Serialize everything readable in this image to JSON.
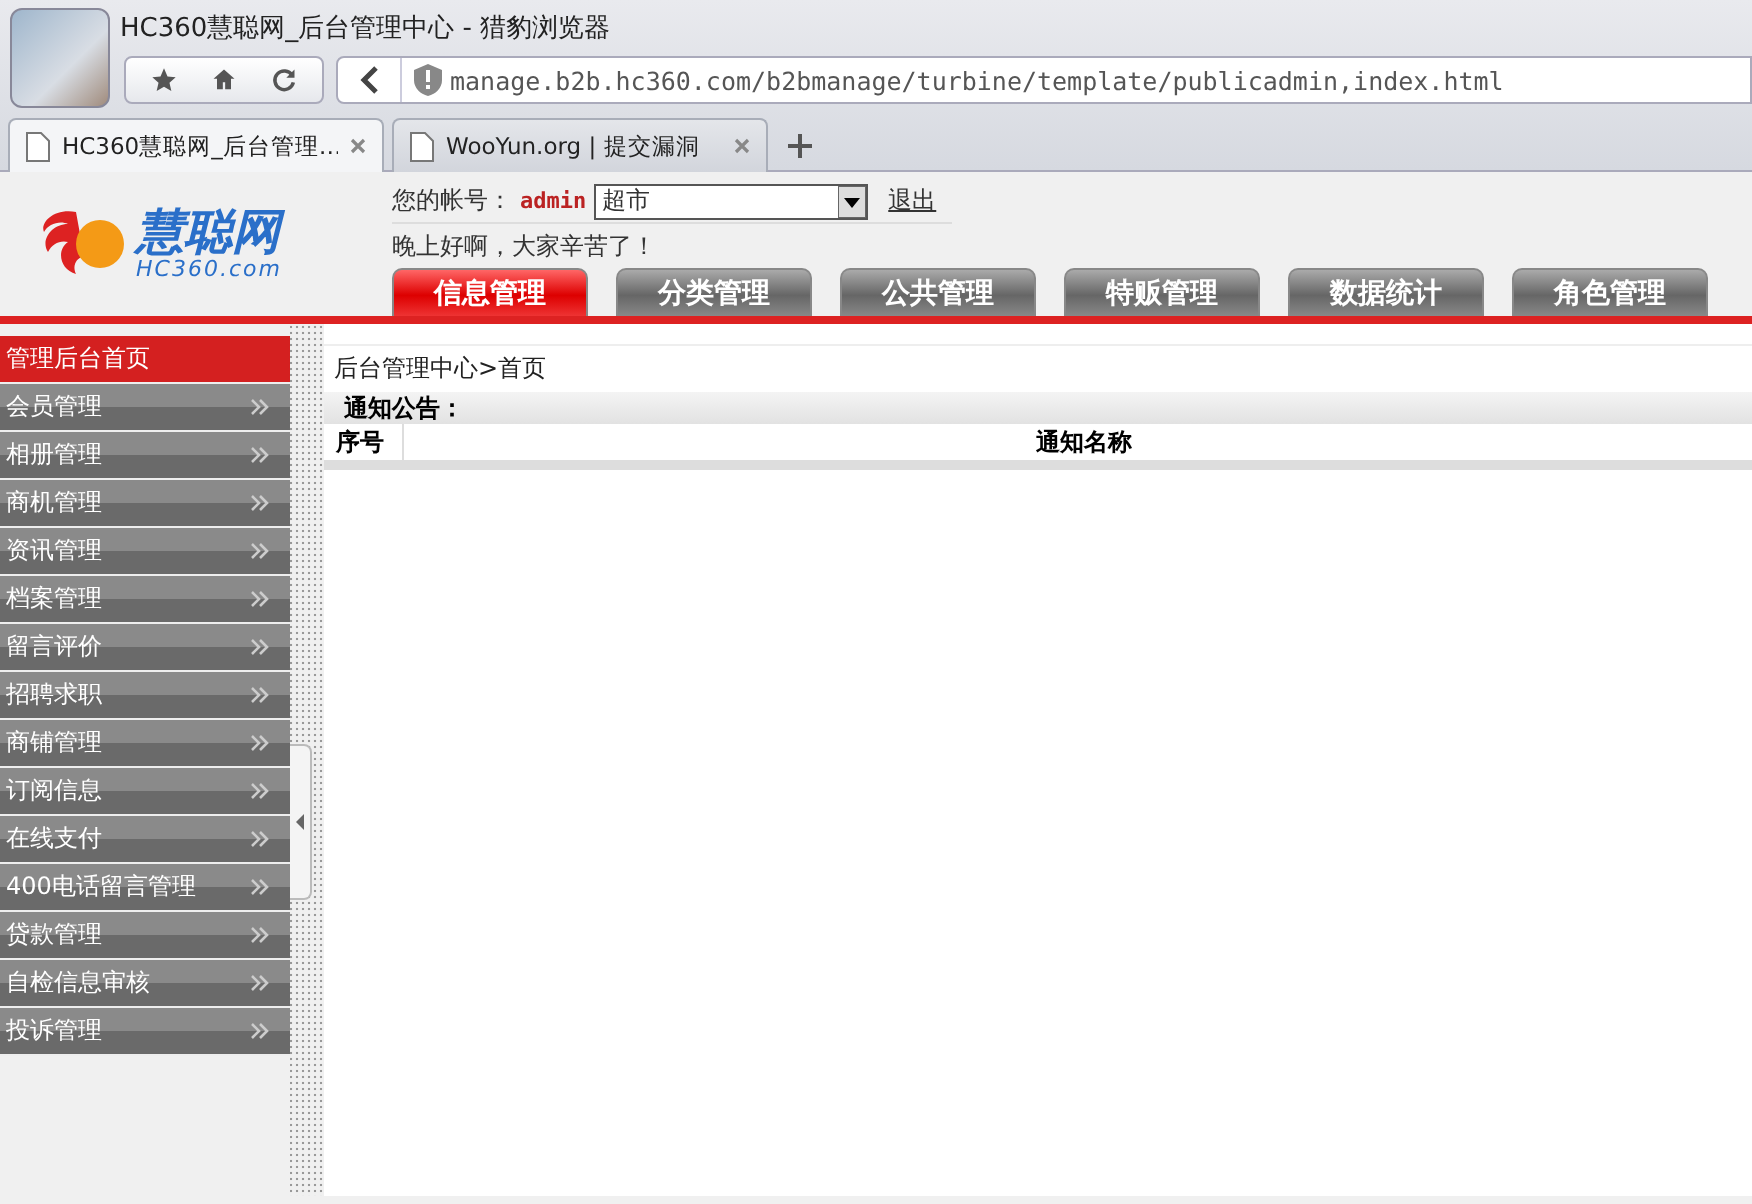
{
  "browser": {
    "title": "HC360慧聪网_后台管理中心 - 猎豹浏览器",
    "url": "manage.b2b.hc360.com/b2bmanage/turbine/template/publicadmin,index.html",
    "tabs": [
      {
        "label": "HC360慧聪网_后台管理…",
        "selected": true
      },
      {
        "label": "WooYun.org | 提交漏洞",
        "selected": false
      }
    ]
  },
  "header": {
    "logo_text": "慧聪网",
    "logo_sub": "HC360.com",
    "account_label": "您的帐号：",
    "account": "admin",
    "site_select": "超市",
    "logout": "退出",
    "greeting": "晚上好啊，大家辛苦了！",
    "nav": [
      {
        "label": "信息管理",
        "selected": true
      },
      {
        "label": "分类管理",
        "selected": false
      },
      {
        "label": "公共管理",
        "selected": false
      },
      {
        "label": "特贩管理",
        "selected": false
      },
      {
        "label": "数据统计",
        "selected": false
      },
      {
        "label": "角色管理",
        "selected": false
      }
    ]
  },
  "sidebar": {
    "items": [
      {
        "label": "管理后台首页",
        "selected": true
      },
      {
        "label": "会员管理",
        "selected": false
      },
      {
        "label": "相册管理",
        "selected": false
      },
      {
        "label": "商机管理",
        "selected": false
      },
      {
        "label": "资讯管理",
        "selected": false
      },
      {
        "label": "档案管理",
        "selected": false
      },
      {
        "label": "留言评价",
        "selected": false
      },
      {
        "label": "招聘求职",
        "selected": false
      },
      {
        "label": "商铺管理",
        "selected": false
      },
      {
        "label": "订阅信息",
        "selected": false
      },
      {
        "label": "在线支付",
        "selected": false
      },
      {
        "label": "400电话留言管理",
        "selected": false
      },
      {
        "label": "贷款管理",
        "selected": false
      },
      {
        "label": "自检信息审核",
        "selected": false
      },
      {
        "label": "投诉管理",
        "selected": false
      }
    ]
  },
  "content": {
    "breadcrumb": "后台管理中心>首页",
    "notice_title": "通知公告：",
    "columns": [
      "序号",
      "通知名称"
    ]
  }
}
